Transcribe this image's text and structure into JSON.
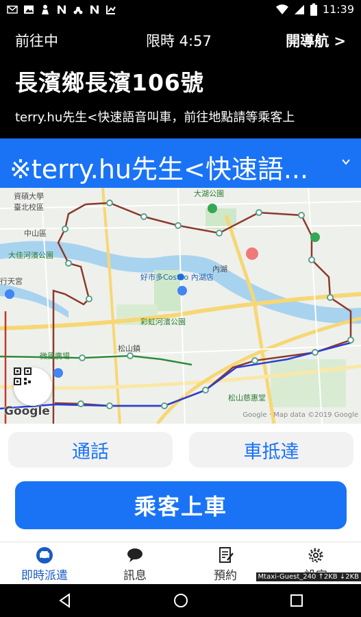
{
  "status_bar": {
    "time": "11:39",
    "left_icons": [
      "mail-icon",
      "image-icon",
      "person-icon",
      "n-icon",
      "scooter-icon",
      "n-icon",
      "speed-icon"
    ],
    "right_icons": [
      "wifi-icon",
      "signal-icon",
      "battery-icon"
    ]
  },
  "header": {
    "status": "前往中",
    "timer": "限時 4:57",
    "navigate": "開導航 >",
    "address": "長濱鄉長濱106號",
    "note": "terry.hu先生<快速語音叫車，前往地點請等乘客上"
  },
  "passenger": {
    "name": "※terry.hu先生<快速語..."
  },
  "map": {
    "labels": {
      "school": "資碩大學\n臺北校區",
      "zhongshan": "中山區",
      "dajia": "大佳河濱公園",
      "tianmu": "行天宮",
      "costco": "好市多Costco 內湖店",
      "caihong": "彩虹河濱公園",
      "songshan": "松山鎮",
      "weidu": "微風廣場",
      "songshan_station": "松山慈惠堂",
      "dahu": "大湖公園",
      "neihu": "內湖"
    },
    "google": "Google",
    "attribution": "Google · Map data ©2019 Google"
  },
  "actions": {
    "call": "通話",
    "arrived": "車抵達",
    "board": "乘客上車"
  },
  "bottom_nav": {
    "items": [
      {
        "label": "即時派遣",
        "icon": "car-icon",
        "active": true
      },
      {
        "label": "訊息",
        "icon": "chat-icon",
        "active": false
      },
      {
        "label": "預約",
        "icon": "document-edit-icon",
        "active": false
      },
      {
        "label": "設定",
        "icon": "gear-icon",
        "active": false
      }
    ],
    "debug": "Mtaxi-Guest_240 ↑2KB ↓2KB"
  },
  "colors": {
    "accent": "#1a73f5",
    "header_bg": "#000000",
    "route": "#8b3a2b"
  }
}
